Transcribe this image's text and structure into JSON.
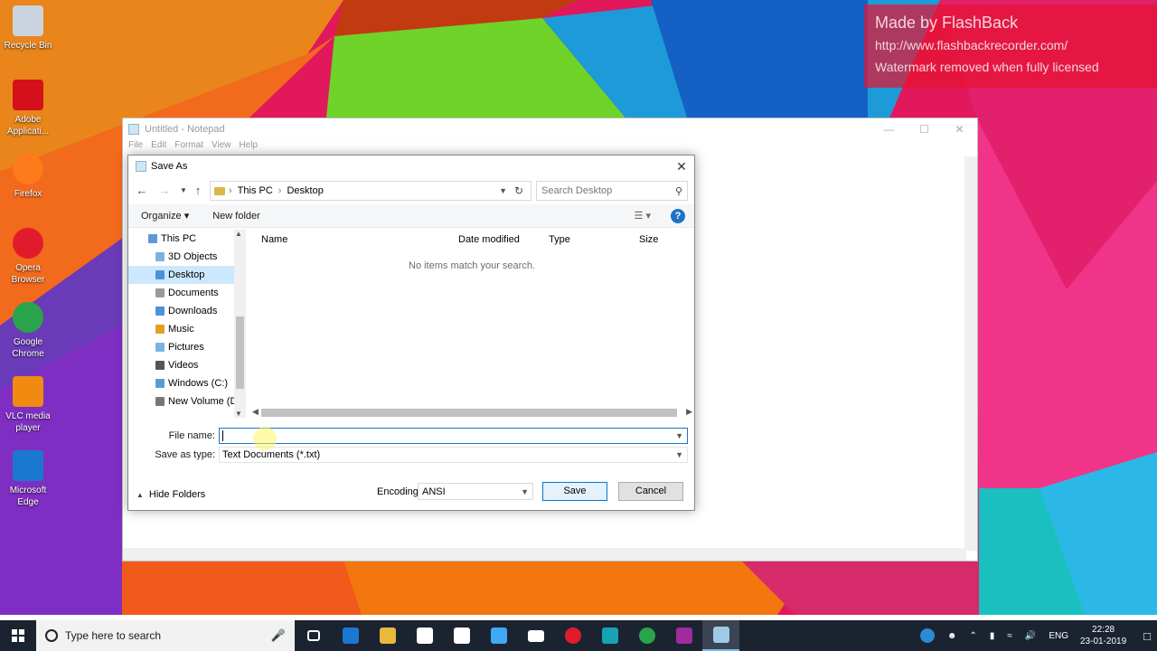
{
  "desktop": {
    "icons": [
      {
        "label_l1": "Recycle Bin",
        "label_l2": "",
        "name": "recycle-bin-icon",
        "color": "#c9d4de"
      },
      {
        "label_l1": "Adobe",
        "label_l2": "Applicati...",
        "name": "adobe-icon",
        "color": "#d6101a"
      },
      {
        "label_l1": "Firefox",
        "label_l2": "",
        "name": "firefox-icon",
        "color": "#ff7a1a"
      },
      {
        "label_l1": "Opera",
        "label_l2": "Browser",
        "name": "opera-icon",
        "color": "#e21b2c"
      },
      {
        "label_l1": "Google",
        "label_l2": "Chrome",
        "name": "chrome-icon",
        "color": "#2aa44a"
      },
      {
        "label_l1": "VLC media",
        "label_l2": "player",
        "name": "vlc-icon",
        "color": "#f08a10"
      },
      {
        "label_l1": "Microsoft",
        "label_l2": "Edge",
        "name": "edge-icon",
        "color": "#1a78d0"
      }
    ]
  },
  "watermark": {
    "line1": "Made by FlashBack",
    "line2": "http://www.flashbackrecorder.com/",
    "line3": "Watermark removed when fully licensed"
  },
  "notepad": {
    "title": "Untitled - Notepad",
    "menu": [
      "File",
      "Edit",
      "Format",
      "View",
      "Help"
    ]
  },
  "dialog": {
    "title": "Save As",
    "address": {
      "root": "This PC",
      "current": "Desktop"
    },
    "search_placeholder": "Search Desktop",
    "toolbar": {
      "organize": "Organize",
      "new_folder": "New folder"
    },
    "nav_items": [
      {
        "label": "This PC",
        "type": "root",
        "color": "#5a9bd5"
      },
      {
        "label": "3D Objects",
        "type": "child",
        "color": "#7ab3e0"
      },
      {
        "label": "Desktop",
        "type": "child",
        "color": "#4d91d8",
        "selected": true
      },
      {
        "label": "Documents",
        "type": "child",
        "color": "#9a9a9a"
      },
      {
        "label": "Downloads",
        "type": "child",
        "color": "#4d91d8"
      },
      {
        "label": "Music",
        "type": "child",
        "color": "#e0a020"
      },
      {
        "label": "Pictures",
        "type": "child",
        "color": "#7ab3e0"
      },
      {
        "label": "Videos",
        "type": "child",
        "color": "#555555"
      },
      {
        "label": "Windows (C:)",
        "type": "child",
        "color": "#5a9bd5"
      },
      {
        "label": "New Volume (D:",
        "type": "child",
        "color": "#777777"
      }
    ],
    "columns": [
      "Name",
      "Date modified",
      "Type",
      "Size"
    ],
    "empty_message": "No items match your search.",
    "file_name_label": "File name:",
    "file_name_value": "",
    "save_as_type_label": "Save as type:",
    "save_as_type_value": "Text Documents (*.txt)",
    "hide_folders": "Hide Folders",
    "encoding_label": "Encoding:",
    "encoding_value": "ANSI",
    "save_button": "Save",
    "cancel_button": "Cancel"
  },
  "taskbar": {
    "search_placeholder": "Type here to search",
    "apps": [
      {
        "name": "task-view-icon",
        "color": "#ffffff"
      },
      {
        "name": "edge-taskbar-icon",
        "color": "#1a78d0"
      },
      {
        "name": "file-explorer-icon",
        "color": "#e8b93a"
      },
      {
        "name": "store-icon",
        "color": "#ffffff"
      },
      {
        "name": "dropbox-icon",
        "color": "#ffffff"
      },
      {
        "name": "flashback-icon",
        "color": "#3fa9f5"
      },
      {
        "name": "mail-icon",
        "color": "#ffffff"
      },
      {
        "name": "opera-taskbar-icon",
        "color": "#e21b2c"
      },
      {
        "name": "app-teal-icon",
        "color": "#17a2b8"
      },
      {
        "name": "chrome-taskbar-icon",
        "color": "#2aa44a"
      },
      {
        "name": "recorder-icon",
        "color": "#a02a9e"
      },
      {
        "name": "notepad-taskbar-icon",
        "color": "#9fc9e6"
      }
    ],
    "language": "ENG",
    "time": "22:28",
    "date": "23-01-2019"
  }
}
